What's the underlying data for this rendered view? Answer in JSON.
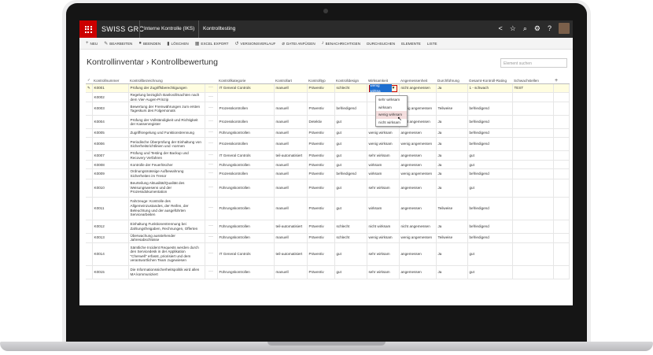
{
  "topbar": {
    "brand": "SWISS GRC",
    "crumbs": [
      "Interne Kontrolle (IKS)",
      "Kontrolltesting"
    ]
  },
  "toolbar": {
    "new": "NEU",
    "edit": "BEARBEITEN",
    "finish": "BEENDEN",
    "delete": "LÖSCHEN",
    "excel": "EXCEL EXPORT",
    "versions": "VERSIONSVERLAUF",
    "attach": "DATEI ANFÜGEN",
    "notify": "BENACHRICHTIGEN",
    "search": "DURCHSUCHEN",
    "items": "ELEMENTE",
    "list": "LISTE"
  },
  "page": {
    "title": "Kontrollinventar › Kontrollbewertung",
    "search_placeholder": "Element suchen"
  },
  "columns": [
    "Kontrollnummer",
    "Kontrollbezeichnung",
    "",
    "Kontrollkategorie",
    "Kontrollart",
    "Kontrolltyp",
    "Kontrolldesign",
    "Wirksamkeit",
    "Angemessenheit",
    "Durchführung",
    "Gesamt-Kontroll-Rating",
    "Schwachstellen"
  ],
  "rows": [
    {
      "nr": "K0001",
      "name": "Prüfung der Zugriffsberechtigungen",
      "cat": "IT General Controls",
      "art": "manuell",
      "typ": "Präventiv",
      "design": "schlecht",
      "wirk": "wenig wirksa",
      "ang": "nicht angemessen",
      "durch": "Ja",
      "rating": "1 - schwach",
      "schwach": "TEST"
    },
    {
      "nr": "K0002",
      "name": "Regelung bezüglich Bankvollmachten nach dem Vier-Augen-Prinzip",
      "cat": "",
      "art": "",
      "typ": "",
      "design": "",
      "wirk": "",
      "ang": "",
      "durch": "",
      "rating": "",
      "schwach": ""
    },
    {
      "nr": "K0003",
      "name": "Bewertung der Fremwährungen zum ersten Tageskurs des Folgemonats",
      "cat": "Prozesskontrollen",
      "art": "manuell",
      "typ": "Präventiv",
      "design": "befriedigend",
      "wirk": "",
      "ang": "wenig angemessen",
      "durch": "Teilweise",
      "rating": "befriedigend",
      "schwach": ""
    },
    {
      "nr": "K0004",
      "name": "Prüfung der Vollständigkeit und Richtigkeit der Kassenregister",
      "cat": "Prozesskontrollen",
      "art": "manuell",
      "typ": "Detektiv",
      "design": "gut",
      "wirk": "",
      "ang": "nicht angemessen",
      "durch": "Ja",
      "rating": "befriedigend",
      "schwach": ""
    },
    {
      "nr": "K0005",
      "name": "Zugriffsregelung und Funktionstrennung",
      "cat": "Führungskontrollen",
      "art": "manuell",
      "typ": "Präventiv",
      "design": "gut",
      "wirk": "wenig wirksam",
      "ang": "angemessen",
      "durch": "Ja",
      "rating": "befriedigend",
      "schwach": ""
    },
    {
      "nr": "K0006",
      "name": "Periodische Überprüfung der Einhaltung von Sicherheitsrichtlinien und -normen",
      "cat": "Prozesskontrollen",
      "art": "manuell",
      "typ": "Präventiv",
      "design": "gut",
      "wirk": "wenig wirksam",
      "ang": "wenig angemessen",
      "durch": "Ja",
      "rating": "befriedigend",
      "schwach": ""
    },
    {
      "nr": "K0007",
      "name": "Prüfung und Testing der Backup und Recovery Verfahren",
      "cat": "IT General Controls",
      "art": "teil-automatisiert",
      "typ": "Präventiv",
      "design": "gut",
      "wirk": "sehr wirksam",
      "ang": "angemessen",
      "durch": "Ja",
      "rating": "gut",
      "schwach": ""
    },
    {
      "nr": "K0008",
      "name": "Kontrolle der Feuerlöscher",
      "cat": "Führungskontrollen",
      "art": "manuell",
      "typ": "Präventiv",
      "design": "gut",
      "wirk": "wirksam",
      "ang": "angemessen",
      "durch": "Ja",
      "rating": "gut",
      "schwach": ""
    },
    {
      "nr": "K0009",
      "name": "Ordnungsmässige Aufbewahrung Sicherheiten im Tresor",
      "cat": "Prozesskontrollen",
      "art": "manuell",
      "typ": "Präventiv",
      "design": "befriedigend",
      "wirk": "wirksam",
      "ang": "wenig angemessen",
      "durch": "Ja",
      "rating": "befriedigend",
      "schwach": ""
    },
    {
      "nr": "K0010",
      "name": "Beurteilung Aktualität/Qualität des Weisungswesens und der Prozessdokumentation",
      "cat": "Führungskontrollen",
      "art": "manuell",
      "typ": "Präventiv",
      "design": "gut",
      "wirk": "sehr wirksam",
      "ang": "angemessen",
      "durch": "Ja",
      "rating": "gut",
      "schwach": ""
    },
    {
      "nr": "K0011",
      "name": "Fahrzeuge: Kontrolle des Allgemeinzustandes, der Reifen, der Beleuchtung und der ausgeführten Servicearbeiten",
      "cat": "Führungskontrollen",
      "art": "manuell",
      "typ": "Präventiv",
      "design": "gut",
      "wirk": "wirksam",
      "ang": "angemessen",
      "durch": "Teilweise",
      "rating": "befriedigend",
      "schwach": ""
    },
    {
      "nr": "K0012",
      "name": "Einhaltung Funktionentrennung bei Zahlungsfreigaben, Rechnungen, Offerten",
      "cat": "Führungskontrollen",
      "art": "teil-automatisiert",
      "typ": "Präventiv",
      "design": "schlecht",
      "wirk": "nicht wirksam",
      "ang": "nicht angemessen",
      "durch": "Ja",
      "rating": "befriedigend",
      "schwach": ""
    },
    {
      "nr": "K0013",
      "name": "Überwachung ausstehender Jahresabschlüsse",
      "cat": "Führungskontrollen",
      "art": "manuell",
      "typ": "Präventiv",
      "design": "schlecht",
      "wirk": "wenig wirksam",
      "ang": "wenig angemessen",
      "durch": "Teilweise",
      "rating": "befriedigend",
      "schwach": ""
    },
    {
      "nr": "K0014",
      "name": "Sämtliche Incident Requests werden durch den Servicedesk in der Applikation \"Cherwell\" erfasst, priorisiert und dem verantwortlichen Team zugewiesen",
      "cat": "IT General Controls",
      "art": "teil-automatisiert",
      "typ": "Präventiv",
      "design": "gut",
      "wirk": "sehr wirksam",
      "ang": "angemessen",
      "durch": "Ja",
      "rating": "gut",
      "schwach": ""
    },
    {
      "nr": "K0015",
      "name": "Die Informationssicherheitspolitik wird allen MA kommuniziert",
      "cat": "Führungskontrollen",
      "art": "manuell",
      "typ": "Präventiv",
      "design": "gut",
      "wirk": "sehr wirksam",
      "ang": "angemessen",
      "durch": "Ja",
      "rating": "gut",
      "schwach": ""
    }
  ],
  "dropdown": {
    "options": [
      "sehr wirksam",
      "wirksam",
      "wenig wirksam",
      "nicht wirksam"
    ],
    "highlighted": "wenig wirksam"
  },
  "colors": {
    "accent": "#cc0000",
    "topbar": "#2b2b2b",
    "selected_row": "#fffde0"
  }
}
